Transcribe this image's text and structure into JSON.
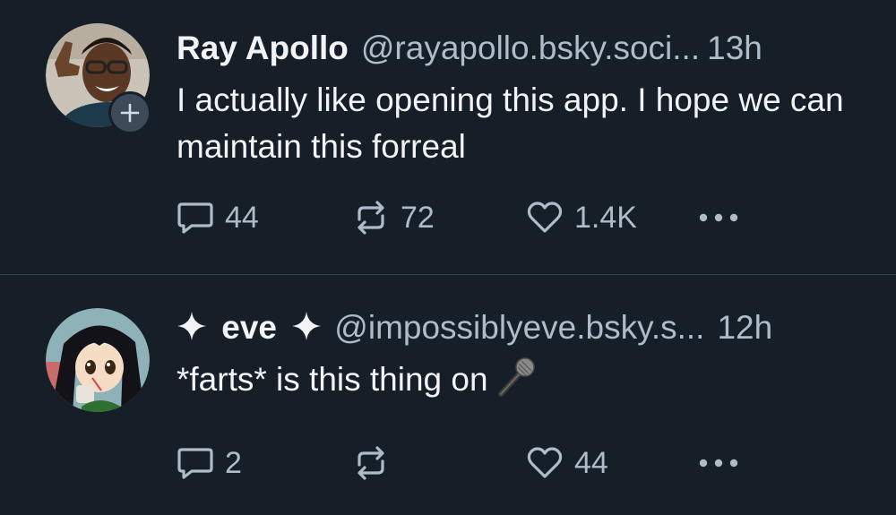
{
  "posts": [
    {
      "display_name": "Ray Apollo",
      "handle": "@rayapollo.bsky.soci...",
      "timestamp": "13h",
      "text": "I actually like opening this app. I hope we can maintain this forreal",
      "avatar_icon": "user-photo-avatar",
      "badge_icon": "plus-icon",
      "reply_count": "44",
      "repost_count": "72",
      "like_count": "1.4K"
    },
    {
      "display_name": "eve",
      "handle": "@impossiblyeve.bsky.s...",
      "timestamp": "12h",
      "text": "*farts* is this thing on",
      "name_decoration_icon": "sparkle-icon",
      "text_emoji": "microphone-icon",
      "avatar_icon": "anime-character-avatar",
      "reply_count": "2",
      "repost_count": "",
      "like_count": "44"
    }
  ],
  "colors": {
    "background": "#161e27",
    "divider": "#2e4052",
    "primary_text": "#f1f3f5",
    "secondary_text": "#aebbc9"
  }
}
